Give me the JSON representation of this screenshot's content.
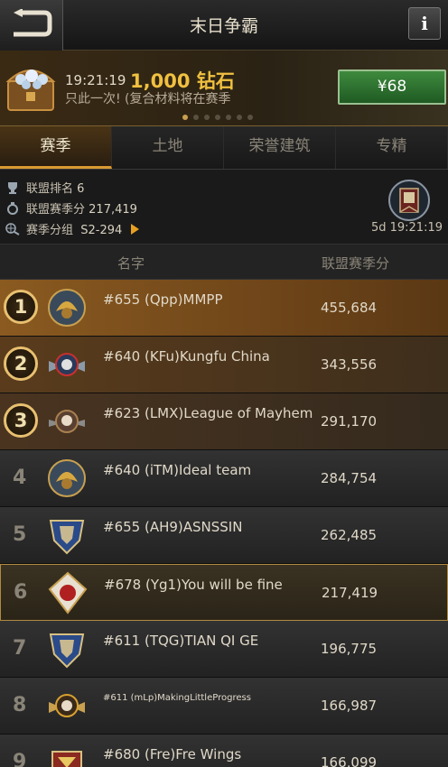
{
  "header": {
    "title": "末日争霸",
    "info_label": "i"
  },
  "promo": {
    "time": "19:21:19",
    "amount": "1,000 钻石",
    "description": "只此一次! (复合材料将在赛季",
    "price": "¥68",
    "page_count": 7,
    "active_page": 1
  },
  "tabs": [
    "赛季",
    "土地",
    "荣誉建筑",
    "专精"
  ],
  "stats": {
    "alliance_rank_label": "联盟排名",
    "alliance_rank": "6",
    "season_score_label": "联盟赛季分",
    "season_score": "217,419",
    "season_group_label": "赛季分组",
    "season_group": "S2-294",
    "season_timer": "5d 19:21:19"
  },
  "list_header": {
    "name": "名字",
    "score": "联盟赛季分"
  },
  "rows": [
    {
      "rank": "1",
      "name": "#655 (Qpp)MMPP",
      "score": "455,684"
    },
    {
      "rank": "2",
      "name": "#640 (KFu)Kungfu China",
      "score": "343,556"
    },
    {
      "rank": "3",
      "name": "#623 (LMX)League of Mayhem",
      "score": "291,170"
    },
    {
      "rank": "4",
      "name": "#640 (iTM)Ideal team",
      "score": "284,754"
    },
    {
      "rank": "5",
      "name": "#655 (AH9)ASNSSIN",
      "score": "262,485"
    },
    {
      "rank": "6",
      "name": "#678 (Yg1)You will be fine",
      "score": "217,419"
    },
    {
      "rank": "7",
      "name": "#611 (TQG)TIAN QI GE",
      "score": "196,775"
    },
    {
      "rank": "8",
      "name": "#611 (mLp)MakingLittleProgress",
      "score": "166,987"
    },
    {
      "rank": "9",
      "name": "#680 (Fre)Fre Wings",
      "score": "166,099"
    }
  ]
}
